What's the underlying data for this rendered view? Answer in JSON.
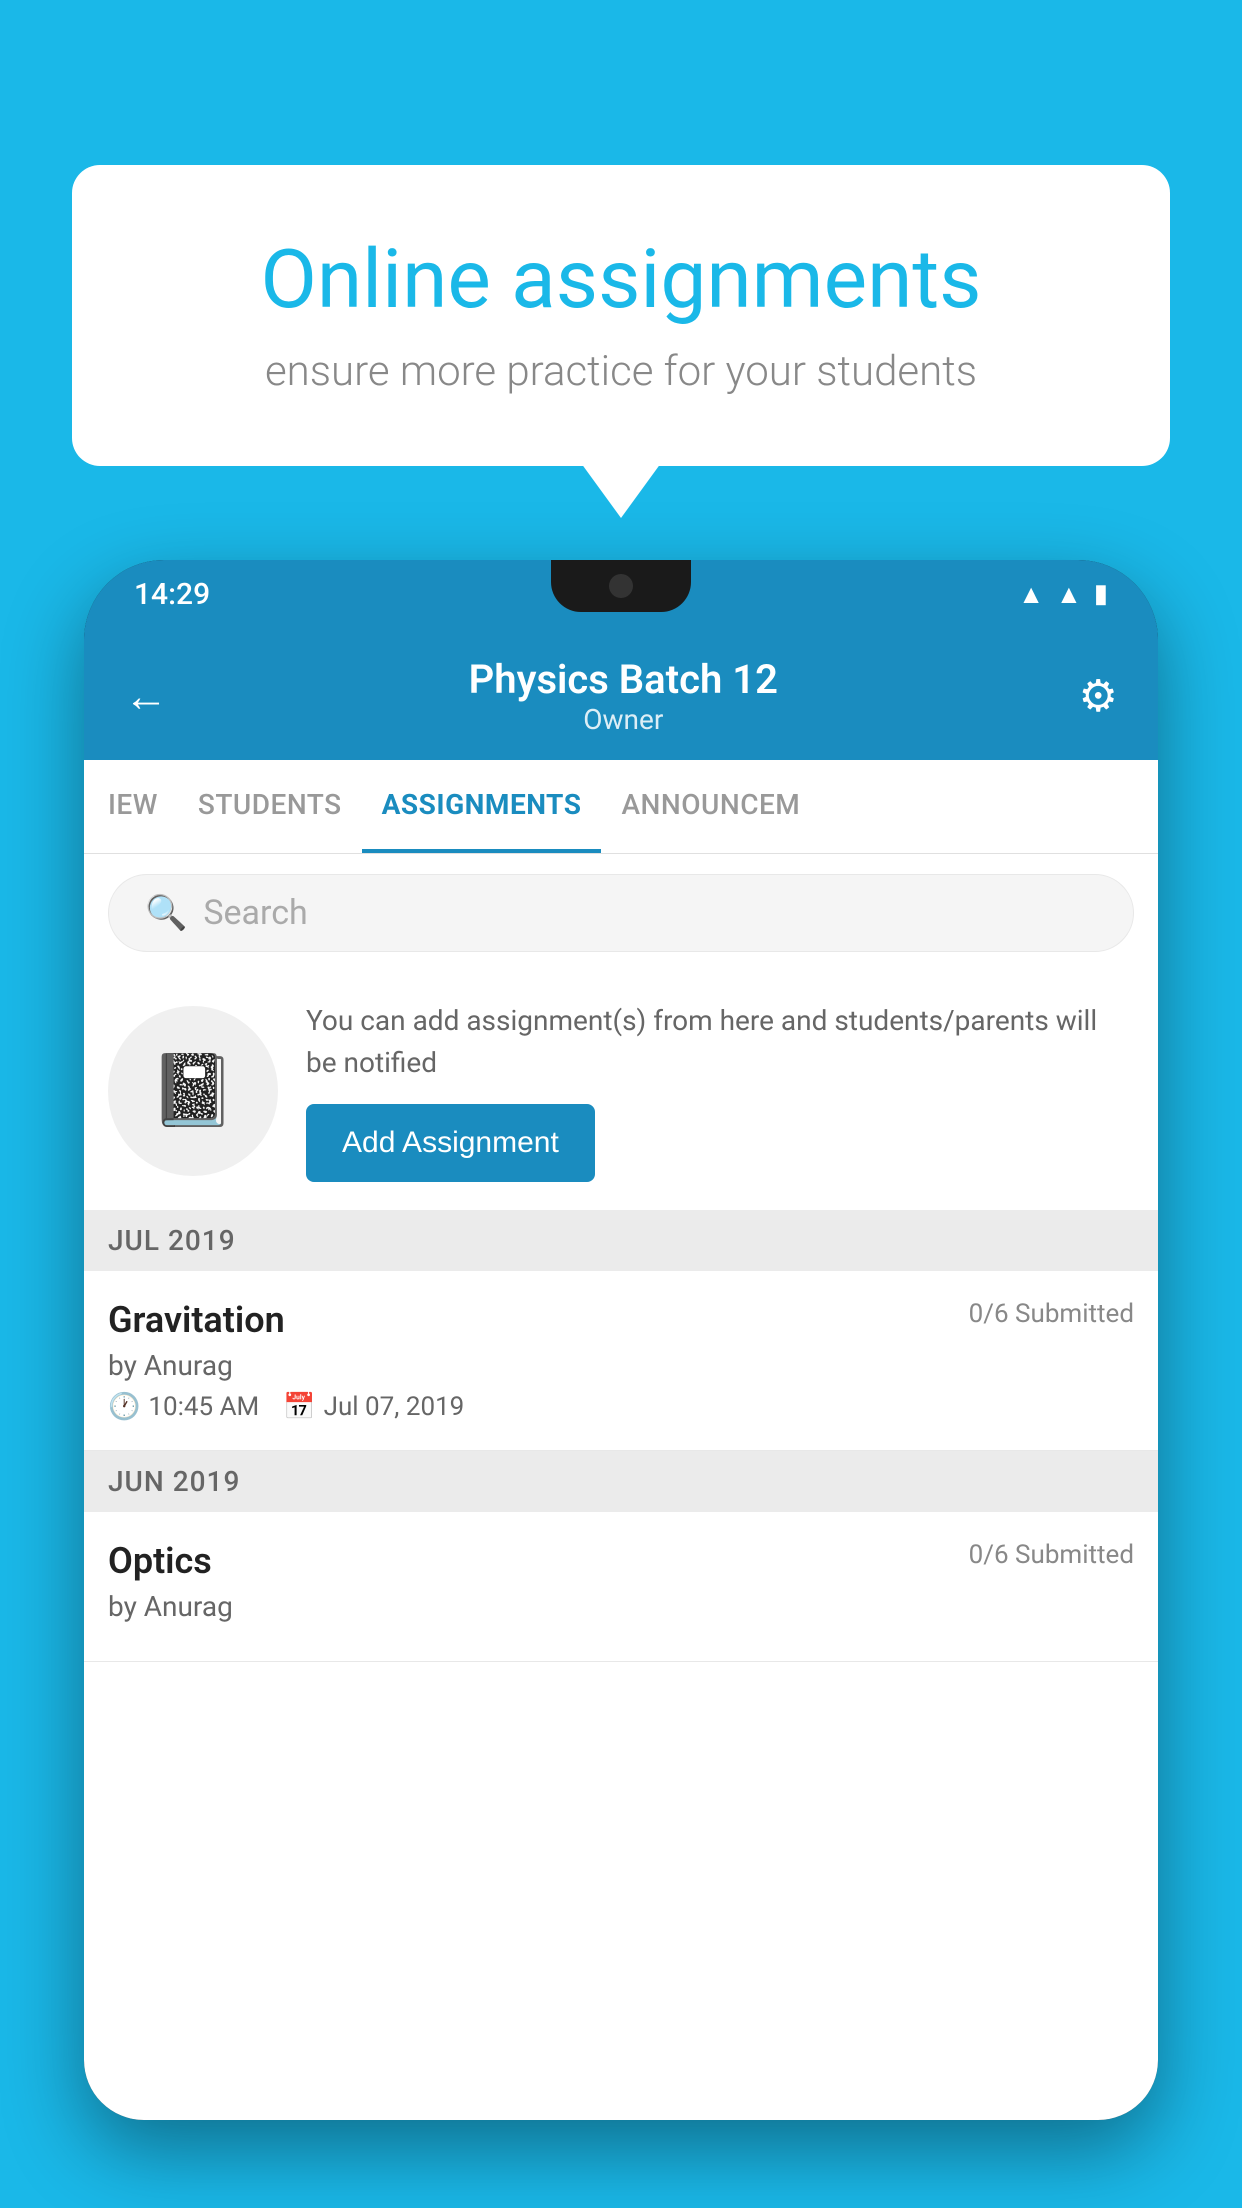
{
  "background_color": "#1ab8e8",
  "speech_bubble": {
    "title": "Online assignments",
    "subtitle": "ensure more practice for your students"
  },
  "phone": {
    "status_bar": {
      "time": "14:29",
      "icons": [
        "wifi",
        "signal",
        "battery"
      ]
    },
    "header": {
      "title": "Physics Batch 12",
      "subtitle": "Owner",
      "back_label": "←",
      "settings_label": "⚙"
    },
    "tabs": [
      {
        "label": "IEW",
        "active": false
      },
      {
        "label": "STUDENTS",
        "active": false
      },
      {
        "label": "ASSIGNMENTS",
        "active": true
      },
      {
        "label": "ANNOUNCEM",
        "active": false
      }
    ],
    "search": {
      "placeholder": "Search"
    },
    "promo": {
      "text": "You can add assignment(s) from here and students/parents will be notified",
      "button_label": "Add Assignment"
    },
    "sections": [
      {
        "month": "JUL 2019",
        "assignments": [
          {
            "name": "Gravitation",
            "submitted": "0/6 Submitted",
            "author": "by Anurag",
            "time": "10:45 AM",
            "date": "Jul 07, 2019"
          }
        ]
      },
      {
        "month": "JUN 2019",
        "assignments": [
          {
            "name": "Optics",
            "submitted": "0/6 Submitted",
            "author": "by Anurag",
            "time": "",
            "date": ""
          }
        ]
      }
    ]
  }
}
